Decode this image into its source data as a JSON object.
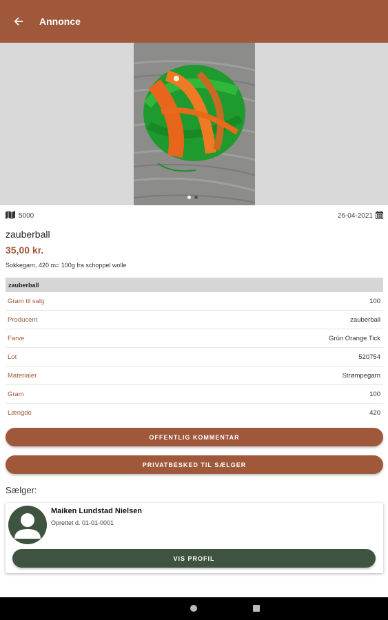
{
  "appbar": {
    "title": "Annonce"
  },
  "listing": {
    "location": "5000",
    "date": "26-04-2021",
    "title": "zauberball",
    "price": "35,00 kr.",
    "description": "Sokkegarn, 420 m= 100g fra schoppel wolle"
  },
  "details": {
    "header": "zauberball",
    "rows": [
      {
        "label": "Gram til salg",
        "value": "100"
      },
      {
        "label": "Producent",
        "value": "zauberball"
      },
      {
        "label": "Farve",
        "value": "Grün Orange Tick"
      },
      {
        "label": "Lot",
        "value": "520754"
      },
      {
        "label": "Materialer",
        "value": "Strømpegarn"
      },
      {
        "label": "Gram",
        "value": "100"
      },
      {
        "label": "Længde",
        "value": "420"
      }
    ]
  },
  "buttons": {
    "public_comment": "OFFENTLIG KOMMENTAR",
    "private_message": "PRIVATBESKED TIL SÆLGER",
    "view_profile": "VIS PROFIL"
  },
  "seller": {
    "label": "Sælger:",
    "name": "Maiken Lundstad Nielsen",
    "created": "Oprettet d. 01-01-0001"
  },
  "carousel": {
    "count": 2,
    "active_index": 0
  },
  "colors": {
    "primary": "#a0583b",
    "secondary": "#3e5340",
    "header_row": "#d6d6d6"
  },
  "icons": [
    "back-arrow-icon",
    "map-icon",
    "calendar-icon",
    "avatar-person-icon",
    "nav-home-icon",
    "nav-recents-icon"
  ]
}
